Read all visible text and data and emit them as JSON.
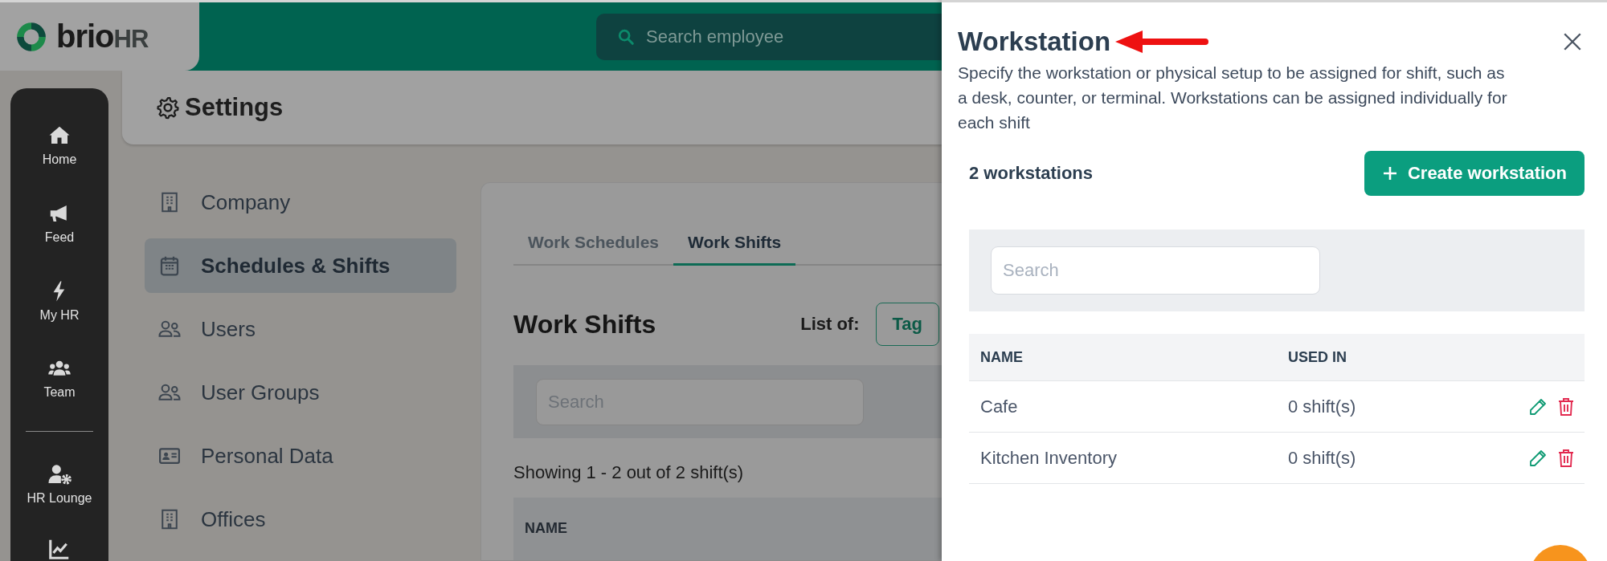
{
  "top_bar": {
    "logo": {
      "name": "brio",
      "suffix": "HR"
    },
    "search": {
      "placeholder": "Search employee"
    }
  },
  "nav_rail": {
    "items": [
      {
        "label": "Home"
      },
      {
        "label": "Feed"
      },
      {
        "label": "My HR"
      },
      {
        "label": "Team"
      }
    ],
    "lower_items": [
      {
        "label": "HR Lounge"
      }
    ]
  },
  "settings_header": {
    "title": "Settings"
  },
  "settings_menu": [
    {
      "label": "Company",
      "selected": false
    },
    {
      "label": "Schedules & Shifts",
      "selected": true
    },
    {
      "label": "Users",
      "selected": false
    },
    {
      "label": "User Groups",
      "selected": false
    },
    {
      "label": "Personal Data",
      "selected": false
    },
    {
      "label": "Offices",
      "selected": false
    }
  ],
  "content": {
    "tabs": [
      {
        "label": "Work Schedules",
        "selected": false
      },
      {
        "label": "Work Shifts",
        "selected": true
      }
    ],
    "title": "Work Shifts",
    "list_of_label": "List of:",
    "list_of_button": "Tag",
    "search": {
      "placeholder": "Search"
    },
    "summary": "Showing 1 - 2 out of 2 shift(s)",
    "columns": [
      "NAME"
    ]
  },
  "drawer": {
    "title": "Workstation",
    "description": "Specify the workstation or physical setup to be assigned for shift, such as a desk, counter, or terminal. Workstations can be assigned individually for each shift",
    "count": "2 workstations",
    "create_button": "Create workstation",
    "search": {
      "placeholder": "Search"
    },
    "columns": [
      "NAME",
      "USED IN"
    ],
    "rows": [
      {
        "name": "Cafe",
        "used_in": "0 shift(s)"
      },
      {
        "name": "Kitchen Inventory",
        "used_in": "0 shift(s)"
      }
    ]
  }
}
